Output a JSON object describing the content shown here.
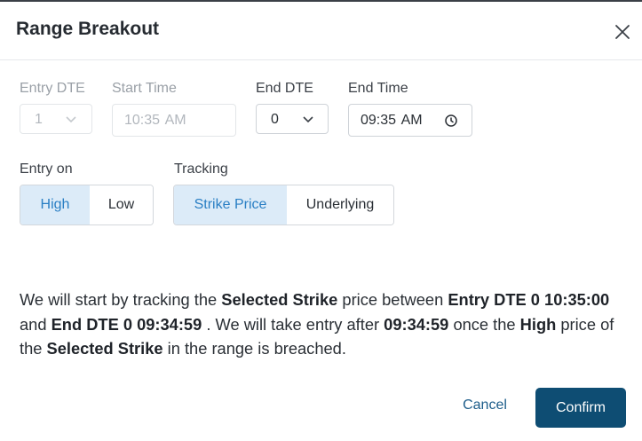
{
  "dialog": {
    "title": "Range Breakout",
    "close_icon": "close-icon"
  },
  "fields": {
    "entry_dte": {
      "label": "Entry DTE",
      "value": "1",
      "disabled": true
    },
    "start_time": {
      "label": "Start Time",
      "value": "10:35 AM",
      "disabled": true
    },
    "end_dte": {
      "label": "End DTE",
      "value": "0"
    },
    "end_time": {
      "label": "End Time",
      "value": "09:35 AM"
    }
  },
  "entry_on": {
    "label": "Entry on",
    "options": [
      "High",
      "Low"
    ],
    "selected": "High"
  },
  "tracking": {
    "label": "Tracking",
    "options": [
      "Strike Price",
      "Underlying"
    ],
    "selected": "Strike Price"
  },
  "message": {
    "t1": "We will start by tracking the ",
    "b1": "Selected Strike",
    "t2": " price between ",
    "b2": "Entry DTE 0 10:35:00",
    "t3": " and ",
    "b3": "End DTE 0 09:34:59",
    "t4": " . We will take entry after ",
    "b4": "09:34:59",
    "t5": " once the ",
    "b5": "High",
    "t6": " price of the ",
    "b6": "Selected Strike",
    "t7": " in the range is breached."
  },
  "actions": {
    "cancel_label": "Cancel",
    "confirm_label": "Confirm"
  },
  "colors": {
    "primary": "#0e4d73",
    "active_segment_bg": "#dcebf8",
    "active_segment_text": "#2a7fc4"
  }
}
